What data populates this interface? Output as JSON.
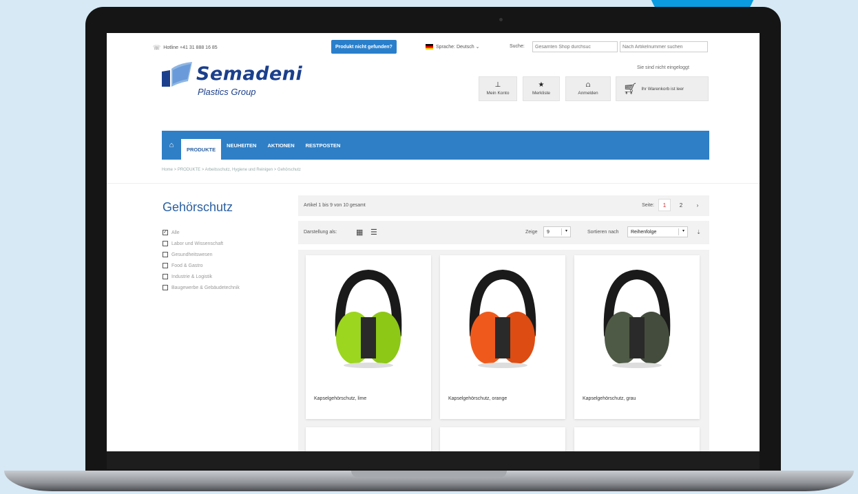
{
  "topbar": {
    "hotline": "Hotline +41 31 888 16 85",
    "not_found_btn": "Produkt nicht gefunden?",
    "language": "Sprache: Deutsch ⌄",
    "search_label": "Suche:",
    "search_placeholder": "Gesamten Shop durchsuc",
    "artnr_placeholder": "Nach Artikelnummer suchen"
  },
  "brand": {
    "name": "Semadeni",
    "subtitle": "Plastics Group",
    "color": "#1b3f8c"
  },
  "account": {
    "status": "Sie sind nicht eingeloggt",
    "my_account": "Mein Konto",
    "wishlist": "Merkliste",
    "login": "Anmelden",
    "cart": "Ihr Warenkorb ist leer"
  },
  "nav": {
    "items": [
      {
        "label": "PRODUKTE"
      },
      {
        "label": "NEUHEITEN"
      },
      {
        "label": "AKTIONEN"
      },
      {
        "label": "RESTPOSTEN"
      }
    ],
    "accent": "#2f7fc6"
  },
  "breadcrumb": "Home > PRODUKTE > Arbeitsschutz, Hygiene und Reinigen > Gehörschutz",
  "category": {
    "title": "Gehörschutz",
    "filters": [
      {
        "label": "Alle",
        "checked": true
      },
      {
        "label": "Labor und Wissenschaft",
        "checked": false
      },
      {
        "label": "Gesundheitswesen",
        "checked": false
      },
      {
        "label": "Food & Gastro",
        "checked": false
      },
      {
        "label": "Industrie & Logistik",
        "checked": false
      },
      {
        "label": "Baugewerbe & Gebäudetechnik",
        "checked": false
      }
    ]
  },
  "toolbar": {
    "count": "Artikel 1 bis 9 von 10 gesamt",
    "page_label": "Seite:",
    "pages": [
      "1",
      "2"
    ],
    "next": "›",
    "view_label": "Darstellung als:",
    "show_label": "Zeige",
    "show_value": "9",
    "sort_label": "Sortieren nach",
    "sort_value": "Reihenfolge"
  },
  "products": [
    {
      "name": "Kapselgehörschutz, lime",
      "color": "#9cd61e"
    },
    {
      "name": "Kapselgehörschutz, orange",
      "color": "#ef5a1c"
    },
    {
      "name": "Kapselgehörschutz, grau",
      "color": "#4f5a46"
    }
  ]
}
